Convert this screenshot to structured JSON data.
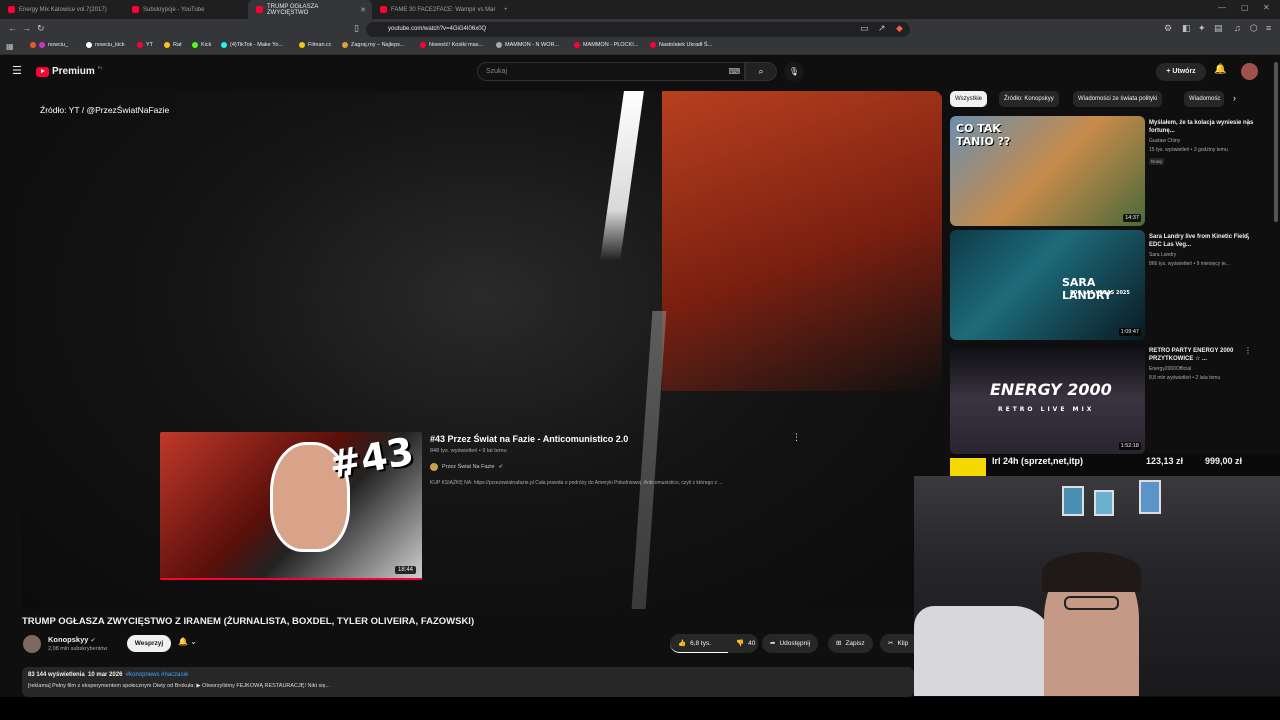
{
  "browser": {
    "tabs": [
      {
        "label": "Energy Mix Katowice vol.7(2017)",
        "active": false
      },
      {
        "label": "Subskrypcje - YouTube",
        "active": false
      },
      {
        "label": "TRUMP OGŁASZA ZWYCIĘSTWO",
        "active": true
      },
      {
        "label": "FAME 30 FACE2FACE: Wampir vs Mar",
        "active": false
      }
    ],
    "new_tab": "+",
    "url": "youtube.com/watch?v=4GiG4I06x0Q",
    "bookmarks": [
      "nowciu_",
      "nowciu_kick",
      "YT",
      "Rat",
      "Kick",
      "(4)TikTok - Make Yo...",
      "Filman.cc",
      "Zagraj.my – Najleps...",
      "Nowość! Kostki mas...",
      "MAMMON - N WOR...",
      "MAMMON - PŁOCKI...",
      "Nastolatek Ukradł Ś..."
    ]
  },
  "youtube": {
    "logo": "Premium",
    "logo_region": "PL",
    "search_placeholder": "Szukaj",
    "create_label": "Utwórz"
  },
  "player": {
    "source_caption": "Źródło: YT / @PrzezŚwiatNaFazie",
    "card": {
      "title": "#43 Przez Świat na Fazie - Anticomunistico 2.0",
      "meta": "848 tys. wyświetleń • 9 lat temu",
      "channel": "Przez Świat Na Fazie",
      "description": "KUP KSIĄŻKĘ NA: https://przezswiatnafazie.pl Cała prawda o podróży do Ameryki Południowej. Anticomunistico, czyli z którego z ...",
      "thumb_number": "#43",
      "duration": "18:44"
    }
  },
  "video": {
    "title": "TRUMP OGŁASZA ZWYCIĘSTWO Z IRANEM (ŻURNALISTA, BOXDEL, TYLER OLIVEIRA, FAZOWSKI)",
    "channel": "Konopskyy",
    "subscribers": "2,08 mln subskrybentów",
    "support_label": "Wesprzyj",
    "likes": "6,8 tys.",
    "dislikes": "40",
    "share_label": "Udostępnij",
    "save_label": "Zapisz",
    "clip_label": "Klip",
    "views": "83 144 wyświetlenia",
    "date": "10 mar 2026",
    "hashtags": "#konopnews #naczasie",
    "description_line": "[reklama] Pełny film z eksperymentem społecznym Diety od Brokuła: ▶ Otworzyliśmy FEJKOWĄ RESTAURACJĘ! Nikt się..."
  },
  "sidebar": {
    "chips": [
      "Wszystkie",
      "Źródło: Konopskyy",
      "Wiadomości ze świata polityki",
      "Wiadomośc"
    ],
    "recommendations": [
      {
        "title": "Myślałem, że ta kolacja wyniesie nas fortunę...",
        "channel": "Gustaw Chiny",
        "meta": "15 tys. wyświetleń • 3 godziny temu",
        "badge": "Nowy",
        "duration": "14:37",
        "thumb_text": "CO TAK TANIO ??"
      },
      {
        "title": "Sara Landry live from Kinetic Field, EDC Las Veg...",
        "channel": "Sara Landry",
        "meta": "866 tys. wyświetleń • 9 miesięcy te...",
        "badge": "",
        "duration": "1:09:47",
        "thumb_text": "SARA LANDRY",
        "thumb_sub": "EDC LAS VEGAS 2025"
      },
      {
        "title": "RETRO PARTY ENERGY 2000 PRZYTKOWICE ☆ ...",
        "channel": "Energy2000Official",
        "meta": "8,8 mln wyświetleń • 2 lata temu",
        "badge": "",
        "duration": "1:52:18",
        "thumb_text": "ENERGY 2000",
        "thumb_sub": "RETRO LIVE MIX"
      }
    ]
  },
  "overlay": {
    "label": "lrl 24h (sprzet,net,itp)",
    "value_a": "123,13 zł",
    "value_b": "999,00 zł"
  },
  "colors": {
    "yt_red": "#ff0033",
    "bg": "#0f0f0f",
    "chip": "#272727",
    "link": "#3ea6ff"
  }
}
